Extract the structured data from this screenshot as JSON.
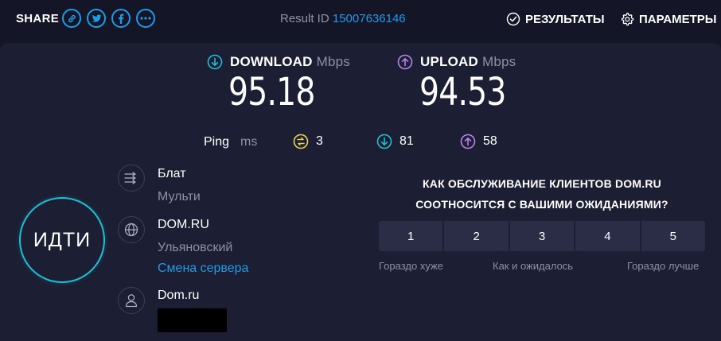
{
  "share": {
    "label": "SHARE"
  },
  "result": {
    "prefix": "Result ID",
    "id": "15007636146"
  },
  "nav": {
    "results": "РЕЗУЛЬТАТЫ",
    "settings": "ПАРАМЕТРЫ"
  },
  "download": {
    "label": "DOWNLOAD",
    "unit": "Mbps",
    "value": "95.18"
  },
  "upload": {
    "label": "UPLOAD",
    "unit": "Mbps",
    "value": "94.53"
  },
  "ping": {
    "label": "Ping",
    "unit": "ms",
    "idle": "3",
    "download": "81",
    "upload": "58"
  },
  "go": {
    "label": "ИДТИ"
  },
  "connection": {
    "title": "Блат",
    "subtitle": "Мульти"
  },
  "server": {
    "title": "DOM.RU",
    "location": "Ульяновский",
    "change_link": "Смена сервера"
  },
  "provider": {
    "title": "Dom.ru"
  },
  "survey": {
    "question_line1": "КАК ОБСЛУЖИВАНИЕ КЛИЕНТОВ DOM.RU",
    "question_line2": "СООТНОСИТСЯ С ВАШИМИ ОЖИДАНИЯМИ?",
    "options": [
      "1",
      "2",
      "3",
      "4",
      "5"
    ],
    "low_label": "Гораздо хуже",
    "mid_label": "Как и ожидалось",
    "high_label": "Гораздо лучше"
  },
  "colors": {
    "accent": "#1e9ce8",
    "download": "#1ec0d8",
    "upload": "#b784e8",
    "ping": "#e8d350",
    "background": "#141526",
    "panel": "#1c1e33"
  }
}
